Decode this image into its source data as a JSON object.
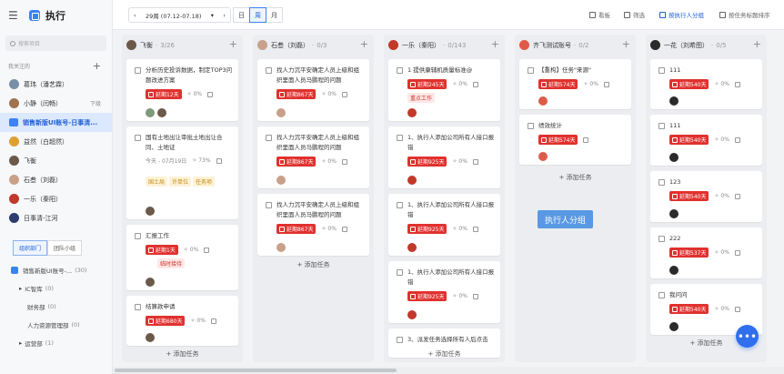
{
  "app": {
    "title": "执行",
    "menu_icon": "menu-icon",
    "logo_icon": "grid-logo-icon"
  },
  "sidebar": {
    "search_placeholder": "搜索项目",
    "section_label": "我关注的",
    "followed": [
      {
        "label": "葛玮（潘艺霖）",
        "color": "#7a8fa6"
      },
      {
        "label": "小静（闫畅）",
        "right": "下级",
        "color": "#a0724e"
      },
      {
        "label": "销售新版UI账号-日事清...",
        "active": true
      },
      {
        "label": "益然（白超然）",
        "color": "#e0a030"
      },
      {
        "label": "飞衡",
        "color": "#6b5a4a"
      },
      {
        "label": "石叁（刘磊）",
        "color": "#c9a08a"
      },
      {
        "label": "一乐（秦阳）",
        "color": "#c0392b"
      },
      {
        "label": "日事清-江河",
        "color": "#2c3e70"
      }
    ],
    "tabs": [
      {
        "label": "组织部门",
        "on": true
      },
      {
        "label": "团队小组",
        "on": false
      }
    ],
    "tree": [
      {
        "label": "销售新版UI账号-...",
        "count": "(30)",
        "indent": 0,
        "icon": "org-icon"
      },
      {
        "label": "IC智库",
        "count": "(0)",
        "indent": 1,
        "arrow": "▸"
      },
      {
        "label": "财务部",
        "count": "(0)",
        "indent": 2
      },
      {
        "label": "人力资源管理部",
        "count": "(0)",
        "indent": 2
      },
      {
        "label": "运营部",
        "count": "(1)",
        "indent": 1,
        "arrow": "▸"
      }
    ]
  },
  "topbar": {
    "date_range": "29周 (07.12-07.18)",
    "prev": "‹",
    "next": "›",
    "caret": "▾",
    "views": [
      {
        "label": "日",
        "on": false
      },
      {
        "label": "周",
        "on": true
      },
      {
        "label": "月",
        "on": false
      }
    ],
    "tools": [
      {
        "label": "看板",
        "icon": "kanban-icon",
        "on": false
      },
      {
        "label": "筛选",
        "icon": "filter-icon",
        "on": false
      },
      {
        "label": "按执行人分组",
        "icon": "group-icon",
        "on": true
      },
      {
        "label": "按任务标题排序",
        "icon": "sort-icon",
        "on": false
      }
    ]
  },
  "columns": [
    {
      "name": "飞衡",
      "count": "3/26",
      "avatar": "#6b5a4a",
      "add": "+ 添加任务",
      "cards": [
        {
          "title": "分析历史投诉数据，制定TOP3问题改进方案",
          "overdue": "延期12天",
          "progress": "0%",
          "avatars": [
            "#7d9a7a",
            "#6b5a4a"
          ]
        },
        {
          "title": "国有土地出让审批土地出让合同、土地证",
          "date": "今天 - 07月19日",
          "progress": "73%",
          "tags": [
            {
              "label": "国土局",
              "bg": "#fff3d6",
              "fg": "#c08a16"
            },
            {
              "label": "许单位",
              "bg": "#fff3d6",
              "fg": "#c08a16"
            },
            {
              "label": "任务项",
              "bg": "#fff3d6",
              "fg": "#c08a16"
            }
          ]
        },
        {
          "title": "汇报工作",
          "overdue": "延期1天",
          "progress": "0%",
          "tag": "临时接待"
        },
        {
          "title": "结算款申请",
          "overdue": "延期680天",
          "progress": "0%"
        }
      ]
    },
    {
      "name": "石叁（刘磊）",
      "count": "0/3",
      "avatar": "#c9a08a",
      "add": "+ 添加任务",
      "cards": [
        {
          "title": "找人力沉平安确定人员上级和组织里面人员马鹏程的问题",
          "overdue": "延期867天",
          "progress": "0%"
        },
        {
          "title": "找人力沉平安确定人员上级和组织里面人员马鹏程的问题",
          "overdue": "延期867天",
          "progress": "0%"
        },
        {
          "title": "找人力沉平安确定人员上级和组织里面人员马鹏程的问题",
          "overdue": "延期867天",
          "progress": "0%"
        }
      ]
    },
    {
      "name": "一乐（秦阳）",
      "count": "0/143",
      "avatar": "#c0392b",
      "add": "+ 添加任务",
      "cards": [
        {
          "title": "1 提供康辅机质量标准@",
          "overdue": "延期245天",
          "progress": "0%",
          "tag": "重点工作"
        },
        {
          "title": "1、执行人添加公司所有人接口报错",
          "overdue": "延期925天",
          "progress": "0%"
        },
        {
          "title": "1、执行人添加公司所有人接口报错",
          "overdue": "延期925天",
          "progress": "0%"
        },
        {
          "title": "1、执行人添加公司所有人接口报错",
          "overdue": "延期925天",
          "progress": "0%"
        },
        {
          "title": "3、派发任务选择所有人后点击"
        }
      ]
    },
    {
      "name": "齐飞测试账号",
      "count": "0/2",
      "avatar": "#e05a4a",
      "add": "+ 添加任务",
      "cards": [
        {
          "title": "【重构】任务\"来源\"",
          "overdue": "延期574天",
          "progress": "0%"
        },
        {
          "title": "绩效统计",
          "overdue": "延期574天"
        }
      ]
    },
    {
      "name": "一花（刘希图）",
      "count": "0/5",
      "avatar": "#2b2b2b",
      "add": "+ 添加任务",
      "cards": [
        {
          "title": "111",
          "overdue": "延期540天",
          "progress": "0%"
        },
        {
          "title": "111",
          "overdue": "延期540天",
          "progress": "0%"
        },
        {
          "title": "123",
          "overdue": "延期540天",
          "progress": "0%"
        },
        {
          "title": "222",
          "overdue": "延期537天",
          "progress": "0%"
        },
        {
          "title": "我问问",
          "overdue": "延期540天",
          "progress": "0%"
        }
      ]
    }
  ],
  "floating_label": "执行人分组",
  "fab_label": "•••"
}
